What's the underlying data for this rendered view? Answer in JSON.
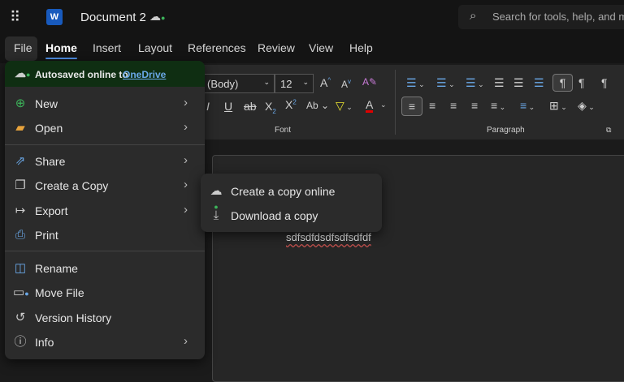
{
  "header": {
    "app": "Word",
    "doc_title": "Document 2",
    "search_placeholder": "Search for tools, help, and m"
  },
  "tabs": [
    "File",
    "Home",
    "Insert",
    "Layout",
    "References",
    "Review",
    "View",
    "Help"
  ],
  "ribbon": {
    "font_name": "(Body)",
    "font_size": "12",
    "font_group": "Font",
    "paragraph_group": "Paragraph"
  },
  "file_menu": {
    "autosave_text": "Autosaved online to",
    "autosave_link": "OneDrive",
    "items": [
      {
        "label": "New"
      },
      {
        "label": "Open"
      },
      {
        "label": "Share"
      },
      {
        "label": "Create a Copy"
      },
      {
        "label": "Export"
      },
      {
        "label": "Print"
      },
      {
        "label": "Rename"
      },
      {
        "label": "Move File"
      },
      {
        "label": "Version History"
      },
      {
        "label": "Info"
      }
    ]
  },
  "submenu": {
    "items": [
      {
        "label": "Create a copy online"
      },
      {
        "label": "Download a copy"
      }
    ]
  },
  "document": {
    "text": "sdfsdfdsdfsdfsdfdf"
  },
  "colors": {
    "accent": "#4f8fe6",
    "autosave_bg": "#0f2e12",
    "success": "#3cb35a"
  }
}
